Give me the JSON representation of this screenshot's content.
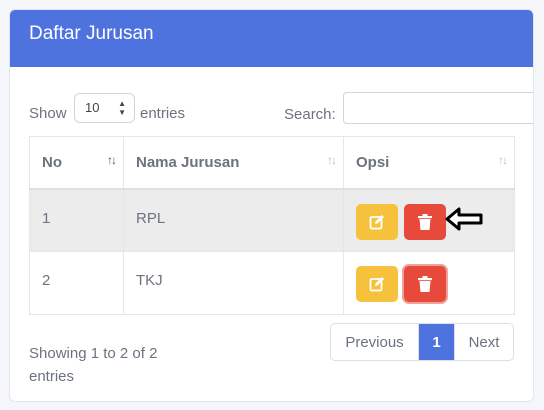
{
  "card": {
    "title": "Daftar Jurusan"
  },
  "controls": {
    "show_label": "Show",
    "page_size": "10",
    "entries_label": "entries",
    "search_label": "Search:",
    "search_value": ""
  },
  "table": {
    "columns": [
      "No",
      "Nama Jurusan",
      "Opsi"
    ],
    "rows": [
      {
        "no": "1",
        "nama": "RPL"
      },
      {
        "no": "2",
        "nama": "TKJ"
      }
    ]
  },
  "footer": {
    "info": "Showing 1 to 2 of 2 entries",
    "prev_label": "Previous",
    "current_page": "1",
    "next_label": "Next"
  },
  "colors": {
    "header": "#4e73df",
    "edit": "#f6c23e",
    "delete": "#e74a3b"
  },
  "icons": {
    "edit": "edit-icon",
    "delete": "trash-icon",
    "pointer": "arrow-left-icon"
  }
}
